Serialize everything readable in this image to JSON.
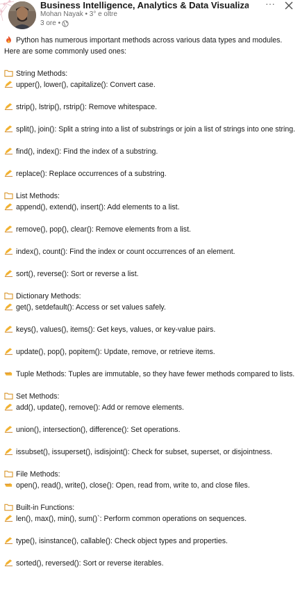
{
  "header": {
    "author_name": "Business Intelligence, Analytics & Data Visualization (...",
    "author_sub": "Mohan Nayak • 3° e oltre",
    "time": "3 ore •",
    "more_label": "···",
    "icons": {
      "more": "more-icon",
      "close": "close-icon",
      "visibility": "globe-icon"
    }
  },
  "post": {
    "intro": "Python has numerous important methods across various data types and modules. Here are some commonly used ones:",
    "sections": [
      {
        "title": "String Methods:",
        "items": [
          "upper(), lower(), capitalize(): Convert case.",
          "strip(), lstrip(), rstrip(): Remove whitespace.",
          "split(), join(): Split a string into a list of substrings or join a list of strings into one string.",
          "find(), index(): Find the index of a substring.",
          "replace(): Replace occurrences of a substring."
        ]
      },
      {
        "title": "List Methods:",
        "items": [
          "append(), extend(), insert(): Add elements to a list.",
          "remove(), pop(), clear(): Remove elements from a list.",
          "index(), count(): Find the index or count occurrences of an element.",
          "sort(), reverse(): Sort or reverse a list."
        ]
      },
      {
        "title": "Dictionary Methods:",
        "items": [
          "get(), setdefault(): Access or set values safely.",
          "keys(), values(), items(): Get keys, values, or key-value pairs.",
          "update(), pop(), popitem(): Update, remove, or retrieve items."
        ]
      },
      {
        "title": "Tuple Methods: Tuples are immutable, so they have fewer methods compared to lists.",
        "items": []
      },
      {
        "title": "Set Methods:",
        "items": [
          "add(), update(), remove(): Add or remove elements.",
          "union(), intersection(), difference(): Set operations.",
          "issubset(), issuperset(), isdisjoint(): Check for subset, superset, or disjointness."
        ]
      },
      {
        "title": "File Methods:",
        "items": [
          "open(), read(), write(), close(): Open, read from, write to, and close files."
        ]
      },
      {
        "title": "Built-in Functions:",
        "items": [
          "len(), max(), min(), sum()`: Perform common operations on sequences.",
          "type(), isinstance(), callable(): Check object types and properties.",
          "sorted(), reversed(): Sort or reverse iterables."
        ]
      }
    ]
  },
  "icons": {
    "intro": "fire-icon",
    "section": "folder-icon",
    "item": "writing-hand-icon",
    "tuple": "pointing-hand-icon"
  },
  "colors": {
    "fire": "#e8542a",
    "folder": "#f0b640",
    "hand": "#f2b232",
    "text": "#1a1a1a",
    "muted": "#666666"
  }
}
